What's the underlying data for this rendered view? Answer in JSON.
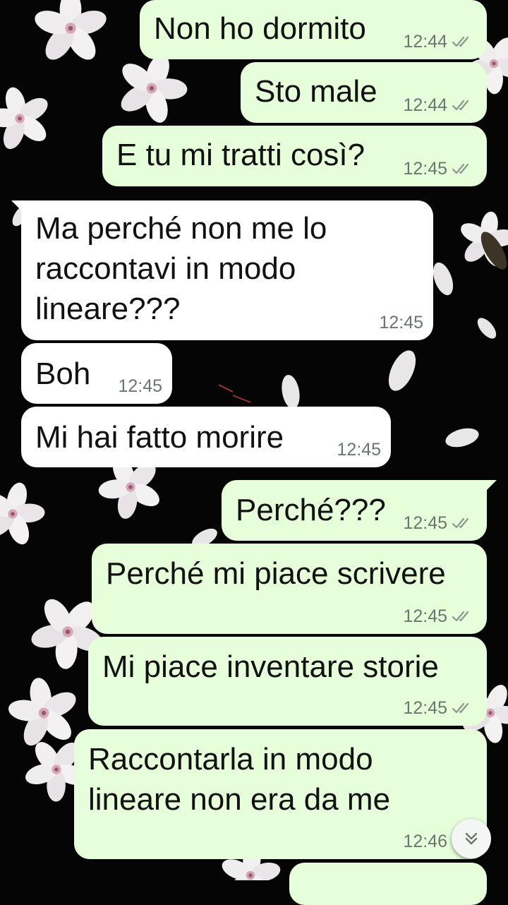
{
  "colors": {
    "outgoing_bubble": "#e6ffda",
    "incoming_bubble": "#ffffff",
    "wallpaper": "#050505",
    "meta_text": "#6b7670"
  },
  "messages": [
    {
      "direction": "outgoing",
      "text": "Non ho dormito",
      "time": "12:44",
      "status": "double-check-icon"
    },
    {
      "direction": "outgoing",
      "text": "Sto male",
      "time": "12:44",
      "status": "double-check-icon"
    },
    {
      "direction": "outgoing",
      "text": "E tu mi tratti così?",
      "time": "12:45",
      "status": "double-check-icon"
    },
    {
      "direction": "incoming",
      "text": "Ma perché non me lo\nraccontavi in modo\nlineare???",
      "time": "12:45"
    },
    {
      "direction": "incoming",
      "text": "Boh",
      "time": "12:45"
    },
    {
      "direction": "incoming",
      "text": "Mi hai fatto morire",
      "time": "12:45"
    },
    {
      "direction": "outgoing",
      "text": "Perché???",
      "time": "12:45",
      "status": "double-check-icon"
    },
    {
      "direction": "outgoing",
      "text": "Perché mi piace scrivere",
      "time": "12:45",
      "status": "double-check-icon"
    },
    {
      "direction": "outgoing",
      "text": "Mi piace inventare storie",
      "time": "12:45",
      "status": "double-check-icon"
    },
    {
      "direction": "outgoing",
      "text": "Raccontarla in modo\nlineare non era da me",
      "time": "12:46"
    }
  ],
  "scroll_button": {
    "icon": "double-chevron-down-icon"
  }
}
